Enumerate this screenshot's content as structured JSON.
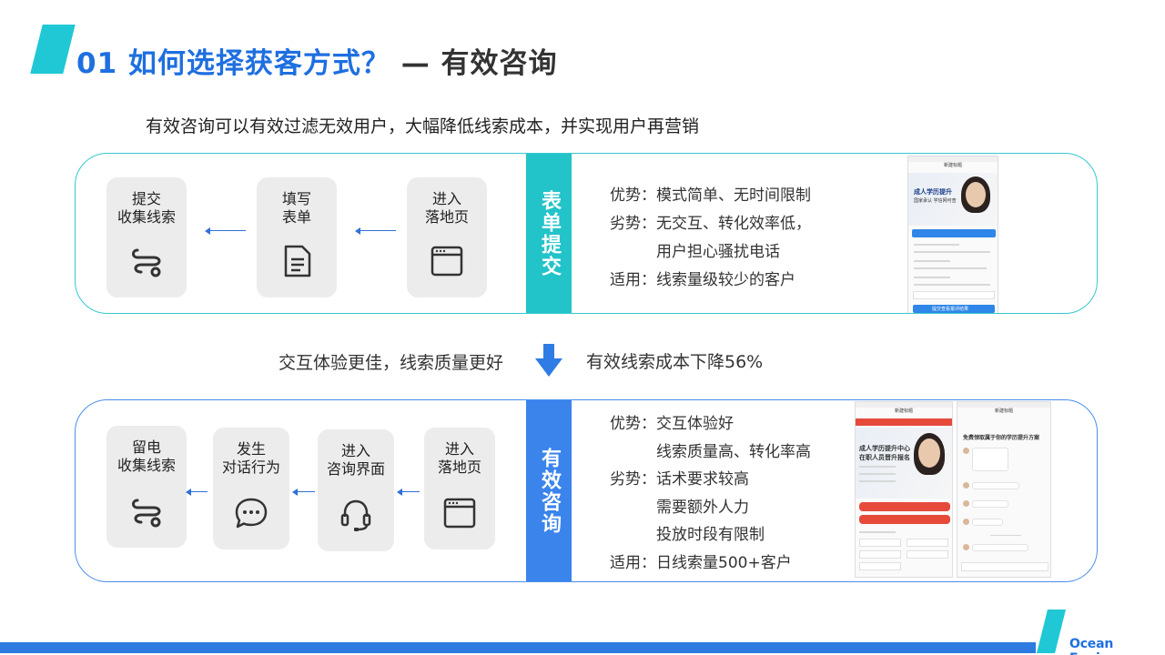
{
  "header": {
    "title_main": "01 如何选择获客方式？",
    "title_sep": " — ",
    "title_sub": "有效咨询"
  },
  "intro": "有效咨询可以有效过滤无效用户，大幅降低线索成本，并实现用户再营销",
  "panel_form": {
    "band_label": "表单提交",
    "steps": [
      {
        "label_1": "提交",
        "label_2": "收集线索",
        "icon": "link-icon"
      },
      {
        "label_1": "填写",
        "label_2": "表单",
        "icon": "document-icon"
      },
      {
        "label_1": "进入",
        "label_2": "落地页",
        "icon": "browser-window-icon"
      }
    ],
    "pros_label": "优势：",
    "pros_value": "模式简单、无时间限制",
    "cons_label": "劣势：",
    "cons_value_1": "无交互、转化效率低，",
    "cons_value_2": "用户担心骚扰电话",
    "fit_label": "适用：",
    "fit_value": "线索量级较少的客户",
    "phone": {
      "header": "新建标题",
      "hero_title": "成人学历提升",
      "hero_sub": "国家承认 学信网可查",
      "cta": "提交查看报评结果"
    }
  },
  "middle": {
    "left": "交互体验更佳，线索质量更好",
    "right": "有效线索成本下降56%"
  },
  "panel_consult": {
    "band_label": "有效咨询",
    "steps": [
      {
        "label_1": "留电",
        "label_2": "收集线索",
        "icon": "link-icon"
      },
      {
        "label_1": "发生",
        "label_2": "对话行为",
        "icon": "chat-bubble-icon"
      },
      {
        "label_1": "进入",
        "label_2": "咨询界面",
        "icon": "headset-icon"
      },
      {
        "label_1": "进入",
        "label_2": "落地页",
        "icon": "browser-window-icon"
      }
    ],
    "pros_label": "优势：",
    "pros_value_1": "交互体验好",
    "pros_value_2": "线索质量高、转化率高",
    "cons_label": "劣势：",
    "cons_value_1": "话术要求较高",
    "cons_value_2": "需要额外人力",
    "cons_value_3": "投放时段有限制",
    "fit_label": "适用：",
    "fit_value": "日线索量500+客户",
    "phone_a": {
      "header": "新建标题",
      "hero_title": "成人学历提升中心",
      "hero_sub": "在职人员晋升报名"
    },
    "phone_b": {
      "header": "新建标题",
      "banner": "免费领取属于你的学历提升方案"
    }
  },
  "footer": {
    "brand": "Ocean Engine"
  },
  "colors": {
    "title_blue": "#1e6fe0",
    "teal": "#22c3c9",
    "blue": "#3a84ec",
    "card_gray": "#ececec"
  }
}
